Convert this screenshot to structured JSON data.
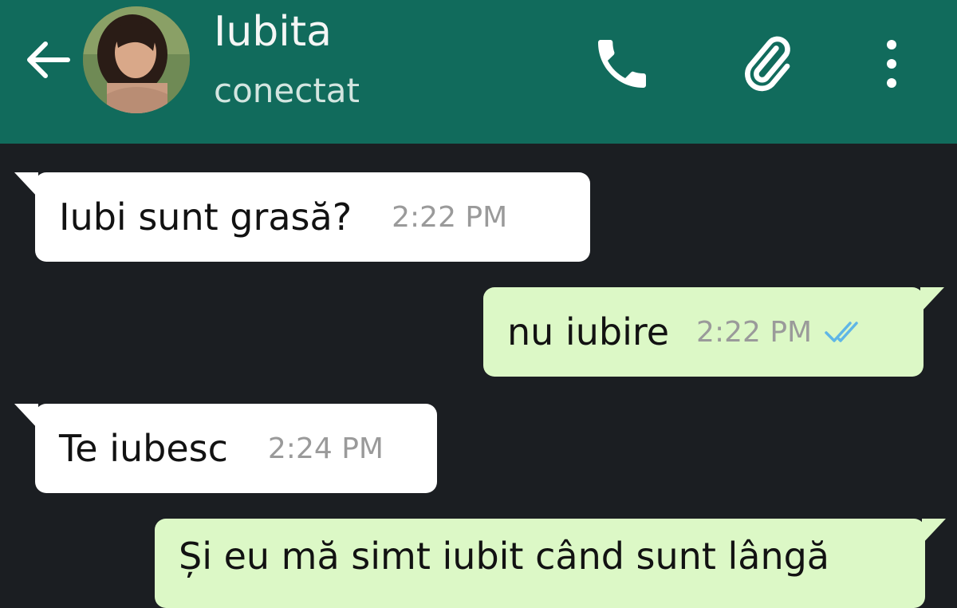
{
  "header": {
    "back_icon": "arrow-left-icon",
    "contact_name": "Iubita",
    "status": "conectat",
    "actions": [
      "phone-icon",
      "paperclip-icon",
      "more-vert-icon"
    ],
    "background_color": "#116b5c"
  },
  "messages": [
    {
      "direction": "incoming",
      "text": "Iubi sunt grasă?",
      "time": "2:22 PM"
    },
    {
      "direction": "outgoing",
      "text": "nu iubire",
      "time": "2:22 PM",
      "status_icon": "double-check-read-icon"
    },
    {
      "direction": "incoming",
      "text": "Te iubesc",
      "time": "2:24 PM"
    },
    {
      "direction": "outgoing",
      "text": "Și eu mă simt iubit când sunt lângă",
      "time": "",
      "partially_visible": true
    }
  ],
  "colors": {
    "chat_background": "#1b1e22",
    "incoming_bubble": "#ffffff",
    "outgoing_bubble": "#dcf8c6",
    "read_tick": "#5fb6e6"
  }
}
